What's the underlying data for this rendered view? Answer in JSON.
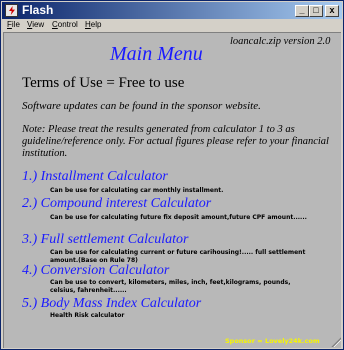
{
  "window": {
    "title": "Flash"
  },
  "titlebar_buttons": {
    "minimize": "_",
    "maximize": "□",
    "close": "x"
  },
  "menu": [
    {
      "accel": "F",
      "rest": "ile"
    },
    {
      "accel": "V",
      "rest": "iew"
    },
    {
      "accel": "C",
      "rest": "ontrol"
    },
    {
      "accel": "H",
      "rest": "elp"
    }
  ],
  "content": {
    "version": "loancalc.zip version 2.0",
    "main_title": "Main Menu",
    "terms": "Terms of Use = Free to use",
    "updates": "Software updates can be found in the sponsor website.",
    "note": "Note: Please treat the results generated from calculator 1 to 3 as guideline/reference only. For actual figures please refer to your financial institution.",
    "calculators": [
      {
        "title": "1.) Installment Calculator",
        "desc": "Can be use for calculating car monthly installment."
      },
      {
        "title": "2.) Compound interest Calculator",
        "desc": "Can be use for calculating future fix deposit amount,future CPF amount......"
      },
      {
        "title": "3.) Full settlement Calculator",
        "desc": "Can be use for calculating current or future carihousing!..... full settlement amount.(Base on Rule 78)"
      },
      {
        "title": "4.) Conversion Calculator",
        "desc": "Can be use to convert, kilometers, miles, inch, feet,kilograms, pounds, celsius, fahrenheit......"
      },
      {
        "title": "5.) Body Mass Index Calculator",
        "desc": "Health Risk calculator"
      }
    ],
    "sponsor": "Sponsor = Lovely24k.com"
  },
  "colors": {
    "accent_blue": "#1a1aff",
    "sponsor_yellow": "#f7f700",
    "content_bg": "#b8b8b8"
  }
}
